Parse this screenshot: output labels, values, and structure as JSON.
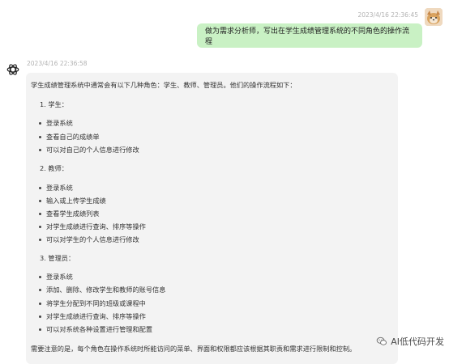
{
  "chat": {
    "user_message": {
      "timestamp": "2023/4/16 22:36:45",
      "text": "做为需求分析师，写出在学生成绩管理系统的不同角色的操作流程"
    },
    "bot_message": {
      "timestamp": "2023/4/16 22:36:58",
      "intro": "学生成绩管理系统中通常会有以下几种角色：学生、教师、管理员。他们的操作流程如下：",
      "roles": [
        {
          "heading": "1. 学生：",
          "items": [
            "登录系统",
            "查看自己的成绩单",
            "可以对自己的个人信息进行修改"
          ]
        },
        {
          "heading": "2. 教师：",
          "items": [
            "登录系统",
            "输入或上传学生成绩",
            "查看学生成绩列表",
            "对学生成绩进行查询、排序等操作",
            "可以对学生的个人信息进行修改"
          ]
        },
        {
          "heading": "3. 管理员：",
          "items": [
            "登录系统",
            "添加、删除、修改学生和教师的账号信息",
            "将学生分配到不同的班级或课程中",
            "对学生成绩进行查询、排序等操作",
            "可以对系统各种设置进行管理和配置"
          ]
        }
      ],
      "note": "需要注意的是，每个角色在操作系统时所能访问的菜单、界面和权限都应该根据其职责和需求进行限制和控制。"
    }
  },
  "watermark": {
    "text": "AI低代码开发",
    "icon": "wechat-icon"
  },
  "colors": {
    "user_bubble": "#c9f1c4",
    "bot_bubble": "#f3f3f3",
    "timestamp": "#b2b2b2"
  },
  "icons": {
    "bot_avatar": "openai-logo-icon",
    "user_avatar": "dog-avatar-icon"
  }
}
